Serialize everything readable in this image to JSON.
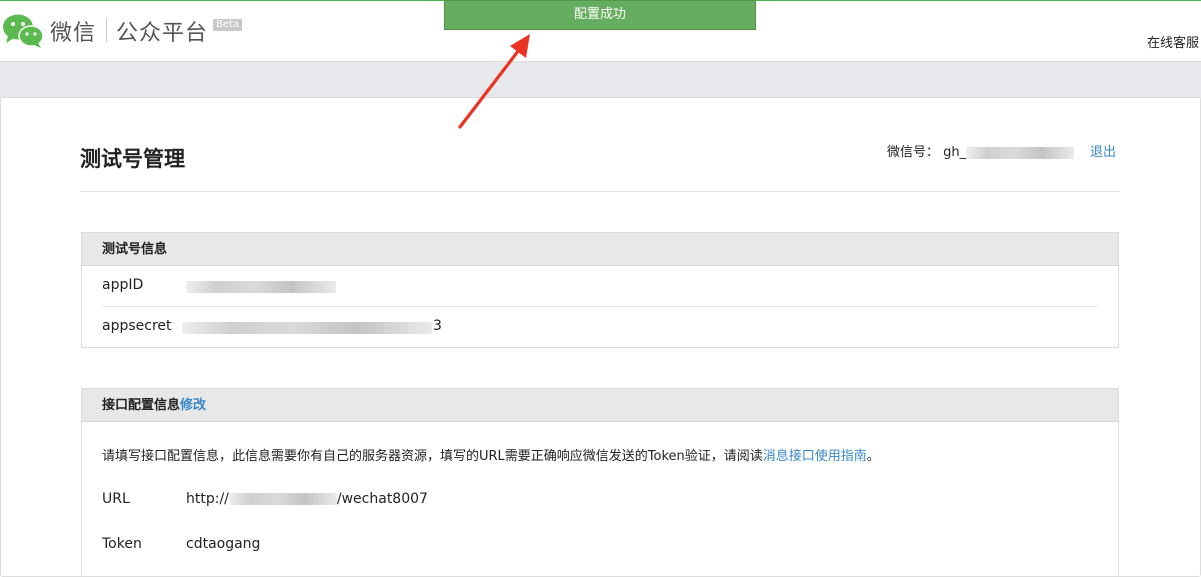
{
  "header": {
    "brand": "微信",
    "brand_sub": "公众平台",
    "beta": "Beta",
    "online_service": "在线客服"
  },
  "toast": {
    "text": "配置成功"
  },
  "page": {
    "title": "测试号管理",
    "account_label": "微信号：",
    "account_prefix": "gh_",
    "logout": "退出"
  },
  "test_info": {
    "heading": "测试号信息",
    "appid_label": "appID",
    "appsecret_label": "appsecret",
    "appsecret_tail": "3"
  },
  "interface_config": {
    "heading": "接口配置信息",
    "modify": "修改",
    "description": "请填写接口配置信息，此信息需要你有自己的服务器资源，填写的URL需要正确响应微信发送的Token验证，请阅读",
    "description_link": "消息接口使用指南",
    "description_end": "。",
    "url_label": "URL",
    "url_prefix": "http://",
    "url_suffix": "/wechat8007",
    "token_label": "Token",
    "token_value": "cdtaogang"
  },
  "colors": {
    "toast_bg": "#65ad5f",
    "link": "#3a88c9",
    "arrow": "#ea3323"
  }
}
